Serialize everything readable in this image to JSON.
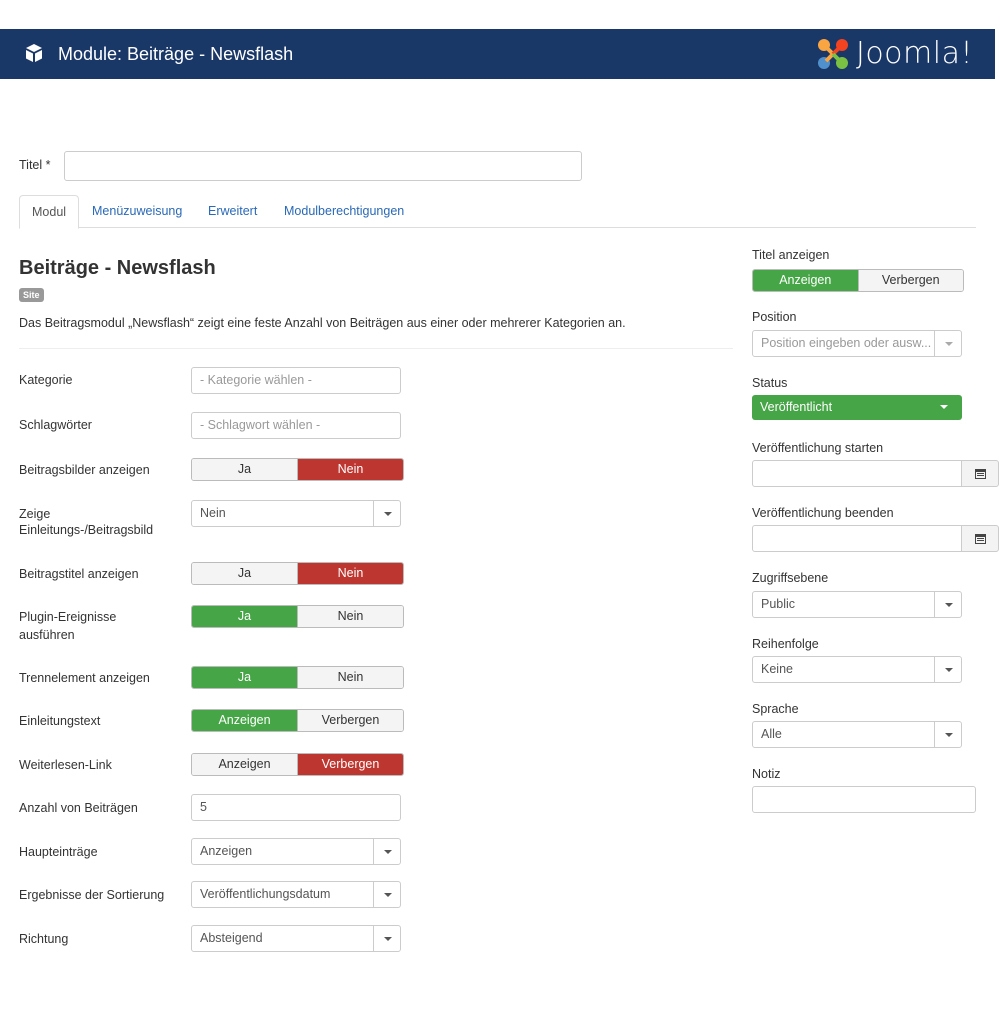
{
  "header": {
    "title": "Module: Beiträge - Newsflash",
    "logo_text": "Joomla!"
  },
  "title_field": {
    "label": "Titel *",
    "value": ""
  },
  "tabs": [
    {
      "label": "Modul",
      "active": true
    },
    {
      "label": "Menüzuweisung"
    },
    {
      "label": "Erweitert"
    },
    {
      "label": "Modulberechtigungen"
    }
  ],
  "module": {
    "heading": "Beiträge - Newsflash",
    "badge": "Site",
    "description": "Das Beitragsmodul „Newsflash“ zeigt eine feste Anzahl von Beiträgen aus einer oder mehrerer Kategorien an."
  },
  "fields": {
    "kategorie": {
      "label": "Kategorie",
      "placeholder": "- Kategorie wählen -"
    },
    "schlagwoerter": {
      "label": "Schlagwörter",
      "placeholder": "- Schlagwort wählen -"
    },
    "beitragsbilder": {
      "label": "Beitragsbilder anzeigen",
      "opt1": "Ja",
      "opt2": "Nein",
      "selected": "Nein"
    },
    "einleitungsbild": {
      "label1": "Zeige",
      "label2": "Einleitungs-/Beitragsbild",
      "value": "Nein"
    },
    "beitragstitel": {
      "label": "Beitragstitel anzeigen",
      "opt1": "Ja",
      "opt2": "Nein",
      "selected": "Nein"
    },
    "plugin": {
      "label1": "Plugin-Ereignisse",
      "label2": "ausführen",
      "opt1": "Ja",
      "opt2": "Nein",
      "selected": "Ja"
    },
    "trennelement": {
      "label": "Trennelement anzeigen",
      "opt1": "Ja",
      "opt2": "Nein",
      "selected": "Ja"
    },
    "einleitungstext": {
      "label": "Einleitungstext",
      "opt1": "Anzeigen",
      "opt2": "Verbergen",
      "selected": "Anzeigen"
    },
    "weiterlesen": {
      "label": "Weiterlesen-Link",
      "opt1": "Anzeigen",
      "opt2": "Verbergen",
      "selected": "Verbergen"
    },
    "anzahl": {
      "label": "Anzahl von Beiträgen",
      "value": "5"
    },
    "haupteintraege": {
      "label": "Haupteinträge",
      "value": "Anzeigen"
    },
    "sortierung": {
      "label": "Ergebnisse der Sortierung",
      "value": "Veröffentlichungsdatum"
    },
    "richtung": {
      "label": "Richtung",
      "value": "Absteigend"
    }
  },
  "sidebar": {
    "titel_anzeigen": {
      "label": "Titel anzeigen",
      "opt1": "Anzeigen",
      "opt2": "Verbergen",
      "selected": "Anzeigen"
    },
    "position": {
      "label": "Position",
      "placeholder": "Position eingeben oder ausw..."
    },
    "status": {
      "label": "Status",
      "value": "Veröffentlicht"
    },
    "publish_up": {
      "label": "Veröffentlichung starten",
      "value": ""
    },
    "publish_down": {
      "label": "Veröffentlichung beenden",
      "value": ""
    },
    "zugriff": {
      "label": "Zugriffsebene",
      "value": "Public"
    },
    "reihenfolge": {
      "label": "Reihenfolge",
      "value": "Keine"
    },
    "sprache": {
      "label": "Sprache",
      "value": "Alle"
    },
    "notiz": {
      "label": "Notiz",
      "value": ""
    }
  },
  "colors": {
    "header_bg": "#1a3867",
    "toggle_green": "#46a546",
    "toggle_red": "#bd362f",
    "link_blue": "#2a69b8"
  },
  "icons": [
    "module-cube-icon",
    "joomla-logo-icon",
    "caret-down-icon",
    "calendar-icon"
  ]
}
